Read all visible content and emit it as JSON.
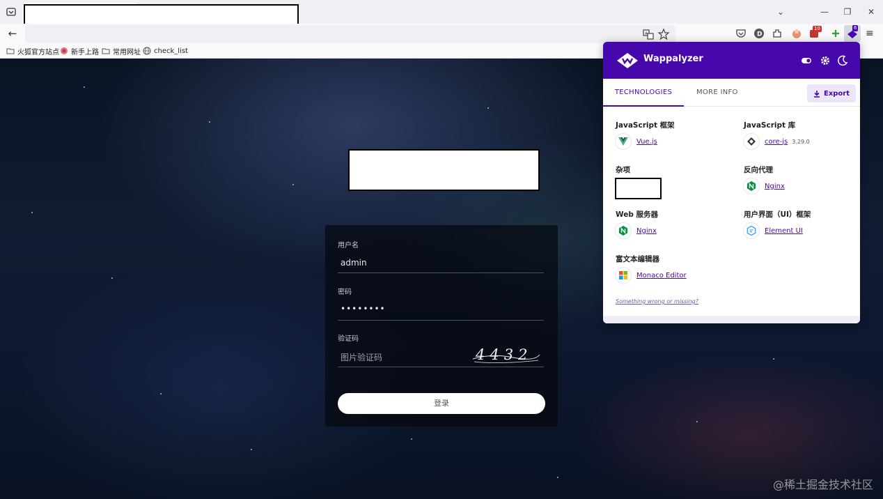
{
  "browser": {
    "bookmarks": [
      {
        "label": "火狐官方站点",
        "icon": "folder-icon"
      },
      {
        "label": "新手上路",
        "icon": "firefox-icon"
      },
      {
        "label": "常用网址",
        "icon": "folder-icon"
      },
      {
        "label": "check_list",
        "icon": "globe-icon"
      }
    ],
    "extension_badges": {
      "adblock": "10",
      "wappalyzer": "6"
    }
  },
  "login": {
    "username_label": "用户名",
    "username_value": "admin",
    "password_label": "密码",
    "password_value": "••••••••",
    "captcha_label": "验证码",
    "captcha_placeholder": "图片验证码",
    "captcha_text": "4432",
    "login_button": "登录"
  },
  "watermark": "@稀土掘金技术社区",
  "wappalyzer": {
    "title": "Wappalyzer",
    "tabs": {
      "technologies": "TECHNOLOGIES",
      "more_info": "MORE INFO"
    },
    "export": "Export",
    "categories": {
      "js_framework": {
        "title": "JavaScript 框架",
        "tech": "Vue.js"
      },
      "js_library": {
        "title": "JavaScript 库",
        "tech": "core-js",
        "version": "3.29.0"
      },
      "misc": {
        "title": "杂项"
      },
      "reverse_proxy": {
        "title": "反向代理",
        "tech": "Nginx"
      },
      "web_server": {
        "title": "Web 服务器",
        "tech": "Nginx"
      },
      "ui_framework": {
        "title": "用户界面（UI）框架",
        "tech": "Element UI"
      },
      "rich_text": {
        "title": "富文本编辑器",
        "tech": "Monaco Editor"
      }
    },
    "footer": "Something wrong or missing?",
    "colors": {
      "brand": "#4608ad",
      "vue": "#41b883",
      "nginx": "#009639",
      "element": "#409eff"
    }
  }
}
